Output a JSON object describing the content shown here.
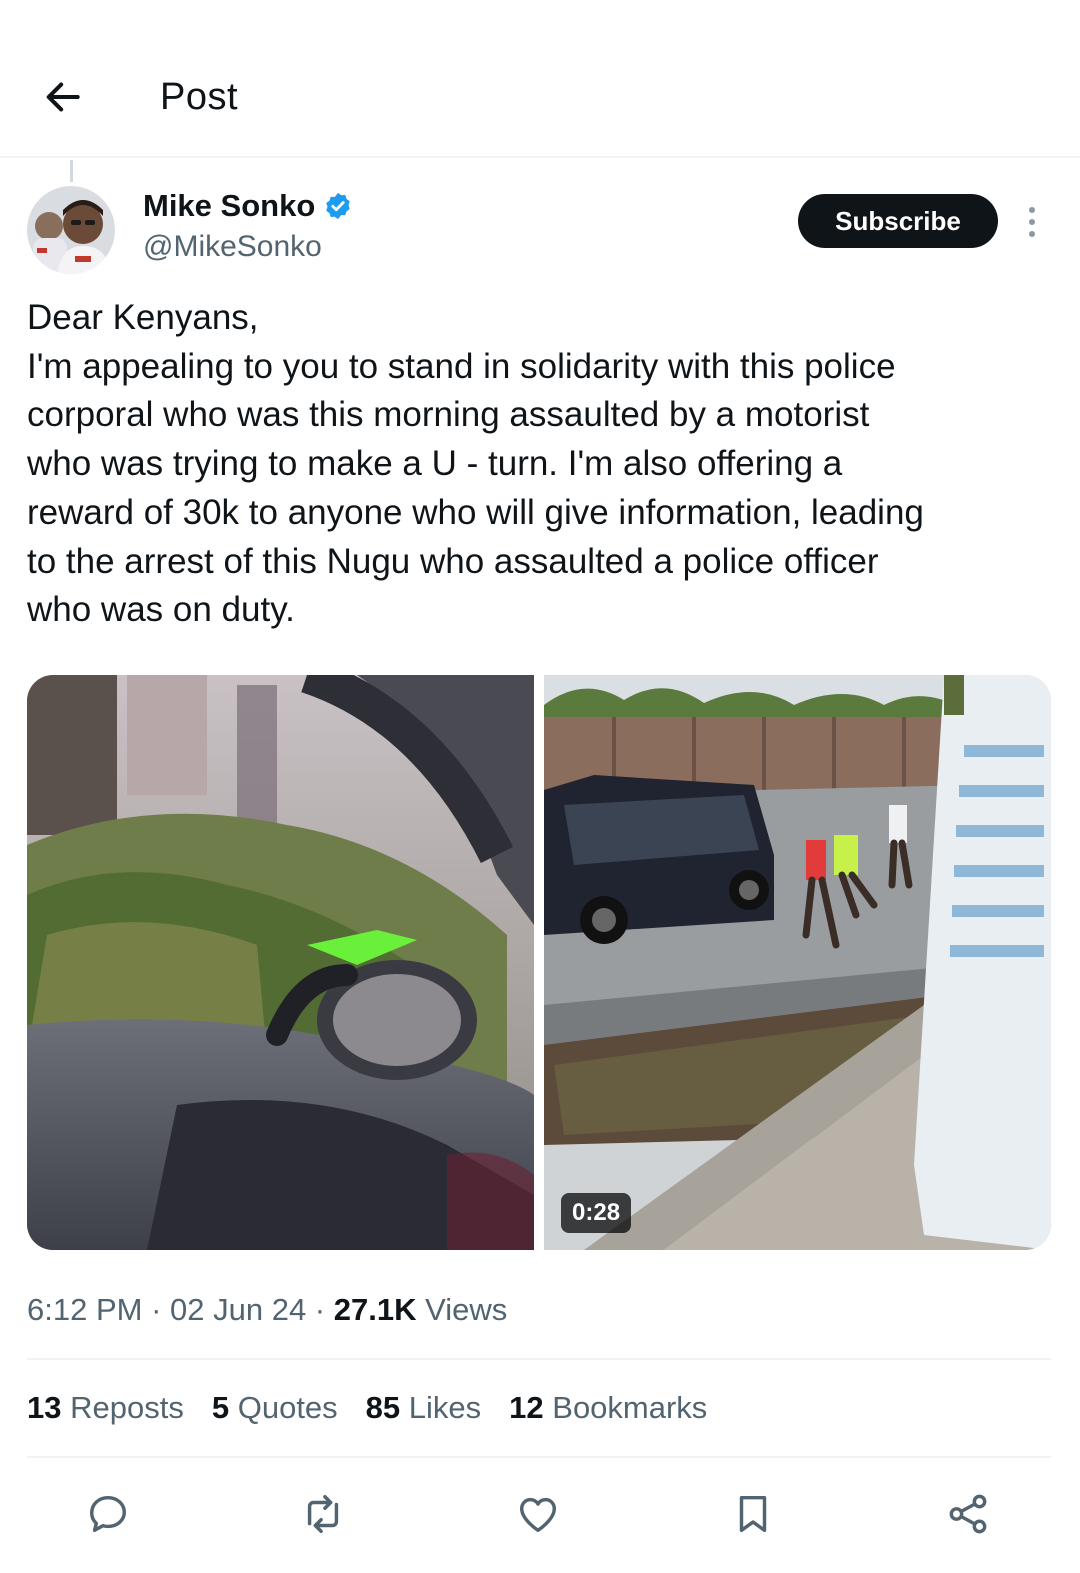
{
  "header": {
    "title": "Post"
  },
  "author": {
    "display_name": "Mike Sonko",
    "handle": "@MikeSonko",
    "subscribe_label": "Subscribe"
  },
  "tweet": {
    "lines": [
      "Dear Kenyans,",
      "I'm appealing to you to stand in solidarity with this police",
      "corporal who was this morning assaulted by a motorist",
      "who was trying to make a U - turn. I'm also offering a",
      "reward of 30k to anyone who will give information, leading",
      "to the arrest of this Nugu who assaulted a police officer",
      "who was on duty."
    ]
  },
  "media": {
    "video_duration": "0:28"
  },
  "meta": {
    "time": "6:12 PM",
    "separator": " · ",
    "date": "02 Jun 24",
    "views_count": "27.1K",
    "views_label": "Views"
  },
  "stats": {
    "reposts_count": "13",
    "reposts_label": "Reposts",
    "quotes_count": "5",
    "quotes_label": "Quotes",
    "likes_count": "85",
    "likes_label": "Likes",
    "bookmarks_count": "12",
    "bookmarks_label": "Bookmarks"
  },
  "icons": {
    "back": "arrow-left-icon",
    "verified": "verified-badge-icon",
    "more": "more-vertical-icon",
    "reply": "reply-icon",
    "repost": "repost-icon",
    "like": "heart-icon",
    "bookmark": "bookmark-icon",
    "share": "share-icon"
  },
  "colors": {
    "verified": "#1d9bf0",
    "text_primary": "#0f1419",
    "text_secondary": "#536471",
    "subscribe_bg": "#0f1419"
  }
}
